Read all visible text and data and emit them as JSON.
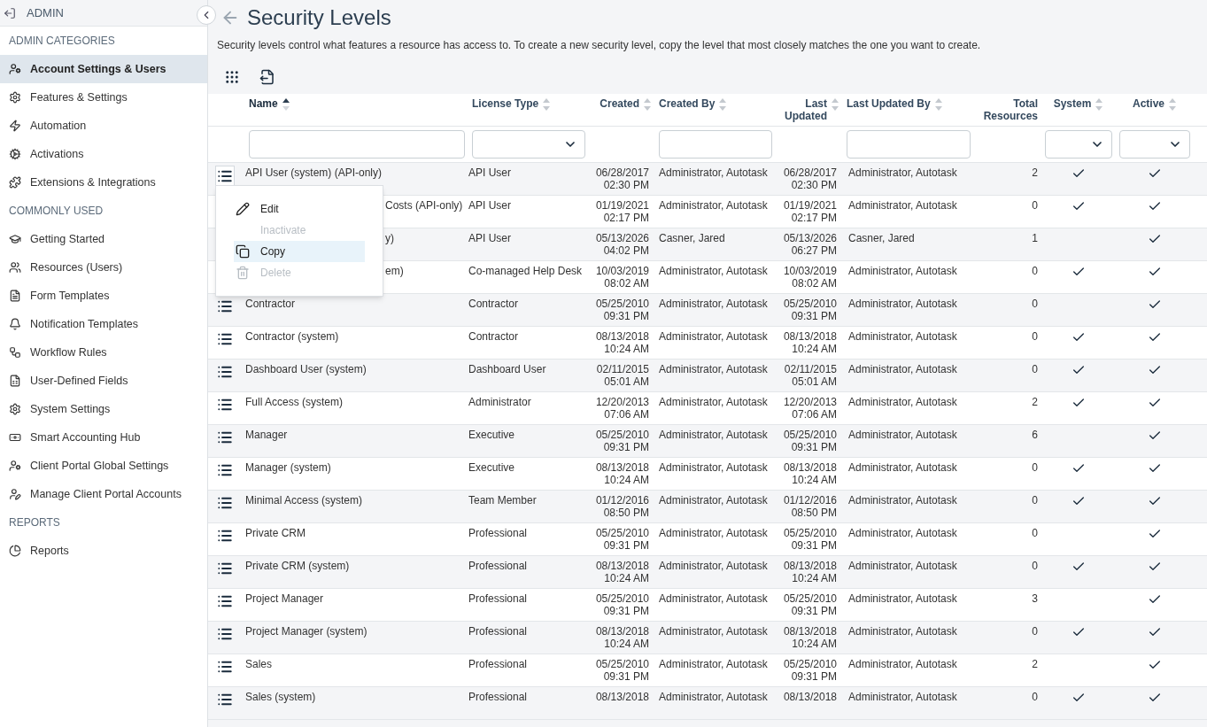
{
  "sidebar": {
    "header": "ADMIN",
    "sections": [
      {
        "title": "ADMIN CATEGORIES",
        "items": [
          {
            "label": "Account Settings & Users",
            "selected": true
          },
          {
            "label": "Features & Settings",
            "selected": false
          },
          {
            "label": "Automation",
            "selected": false
          },
          {
            "label": "Activations",
            "selected": false
          },
          {
            "label": "Extensions & Integrations",
            "selected": false
          }
        ]
      },
      {
        "title": "COMMONLY USED",
        "items": [
          {
            "label": "Getting Started",
            "selected": false
          },
          {
            "label": "Resources (Users)",
            "selected": false
          },
          {
            "label": "Form Templates",
            "selected": false
          },
          {
            "label": "Notification Templates",
            "selected": false
          },
          {
            "label": "Workflow Rules",
            "selected": false
          },
          {
            "label": "User-Defined Fields",
            "selected": false
          },
          {
            "label": "System Settings",
            "selected": false
          },
          {
            "label": "Smart Accounting Hub",
            "selected": false
          },
          {
            "label": "Client Portal Global Settings",
            "selected": false
          },
          {
            "label": "Manage Client Portal Accounts",
            "selected": false
          }
        ]
      },
      {
        "title": "REPORTS",
        "items": [
          {
            "label": "Reports",
            "selected": false
          }
        ]
      }
    ]
  },
  "page": {
    "title": "Security Levels",
    "description": "Security levels control what features a resource has access to. To create a new security level, copy the level that most closely matches the one you want to create."
  },
  "table": {
    "columns": [
      {
        "label": "Name",
        "sortable": true,
        "sorted": true,
        "filter": {
          "kind": "text"
        }
      },
      {
        "label": "License Type",
        "sortable": true,
        "sorted": false,
        "filter": {
          "kind": "select"
        }
      },
      {
        "label": "Created",
        "sortable": true,
        "sorted": false
      },
      {
        "label": "Created By",
        "sortable": true,
        "sorted": false,
        "filter": {
          "kind": "text"
        }
      },
      {
        "label": "Last Updated",
        "sortable": true,
        "sorted": false
      },
      {
        "label": "Last Updated By",
        "sortable": true,
        "sorted": false,
        "filter": {
          "kind": "text"
        }
      },
      {
        "label": "Total Resources",
        "sortable": false,
        "sorted": false
      },
      {
        "label": "System",
        "sortable": true,
        "sorted": false,
        "filter": {
          "kind": "select"
        }
      },
      {
        "label": "Active",
        "sortable": true,
        "sorted": false,
        "filter": {
          "kind": "select"
        }
      }
    ],
    "rows": [
      {
        "name": "API User (system) (API-only)",
        "license": "API User",
        "created_date": "06/28/2017",
        "created_time": "02:30 PM",
        "created_by": "Administrator, Autotask",
        "updated_date": "06/28/2017",
        "updated_time": "02:30 PM",
        "updated_by": "Administrator, Autotask",
        "total": "2",
        "system": true,
        "active": true,
        "menu_open": true
      },
      {
        "name": "Costs (API-only)",
        "license": "API User",
        "created_date": "01/19/2021",
        "created_time": "02:17 PM",
        "created_by": "Administrator, Autotask",
        "updated_date": "01/19/2021",
        "updated_time": "02:17 PM",
        "updated_by": "Administrator, Autotask",
        "total": "0",
        "system": true,
        "active": true,
        "covered": true
      },
      {
        "name": "y)",
        "license": "API User",
        "created_date": "05/13/2026",
        "created_time": "04:02 PM",
        "created_by": "Casner, Jared",
        "updated_date": "05/13/2026",
        "updated_time": "06:27 PM",
        "updated_by": "Casner, Jared",
        "total": "1",
        "system": false,
        "active": true,
        "covered": true
      },
      {
        "name": "em)",
        "license": "Co-managed Help Desk",
        "created_date": "10/03/2019",
        "created_time": "08:02 AM",
        "created_by": "Administrator, Autotask",
        "updated_date": "10/03/2019",
        "updated_time": "08:02 AM",
        "updated_by": "Administrator, Autotask",
        "total": "0",
        "system": true,
        "active": true,
        "covered": true
      },
      {
        "name": "Contractor",
        "license": "Contractor",
        "created_date": "05/25/2010",
        "created_time": "09:31 PM",
        "created_by": "Administrator, Autotask",
        "updated_date": "05/25/2010",
        "updated_time": "09:31 PM",
        "updated_by": "Administrator, Autotask",
        "total": "0",
        "system": false,
        "active": true
      },
      {
        "name": "Contractor (system)",
        "license": "Contractor",
        "created_date": "08/13/2018",
        "created_time": "10:24 AM",
        "created_by": "Administrator, Autotask",
        "updated_date": "08/13/2018",
        "updated_time": "10:24 AM",
        "updated_by": "Administrator, Autotask",
        "total": "0",
        "system": true,
        "active": true
      },
      {
        "name": "Dashboard User (system)",
        "license": "Dashboard User",
        "created_date": "02/11/2015",
        "created_time": "05:01 AM",
        "created_by": "Administrator, Autotask",
        "updated_date": "02/11/2015",
        "updated_time": "05:01 AM",
        "updated_by": "Administrator, Autotask",
        "total": "0",
        "system": true,
        "active": true
      },
      {
        "name": "Full Access (system)",
        "license": "Administrator",
        "created_date": "12/20/2013",
        "created_time": "07:06 AM",
        "created_by": "Administrator, Autotask",
        "updated_date": "12/20/2013",
        "updated_time": "07:06 AM",
        "updated_by": "Administrator, Autotask",
        "total": "2",
        "system": true,
        "active": true
      },
      {
        "name": "Manager",
        "license": "Executive",
        "created_date": "05/25/2010",
        "created_time": "09:31 PM",
        "created_by": "Administrator, Autotask",
        "updated_date": "05/25/2010",
        "updated_time": "09:31 PM",
        "updated_by": "Administrator, Autotask",
        "total": "6",
        "system": false,
        "active": true
      },
      {
        "name": "Manager (system)",
        "license": "Executive",
        "created_date": "08/13/2018",
        "created_time": "10:24 AM",
        "created_by": "Administrator, Autotask",
        "updated_date": "08/13/2018",
        "updated_time": "10:24 AM",
        "updated_by": "Administrator, Autotask",
        "total": "0",
        "system": true,
        "active": true
      },
      {
        "name": "Minimal Access (system)",
        "license": "Team Member",
        "created_date": "01/12/2016",
        "created_time": "08:50 PM",
        "created_by": "Administrator, Autotask",
        "updated_date": "01/12/2016",
        "updated_time": "08:50 PM",
        "updated_by": "Administrator, Autotask",
        "total": "0",
        "system": true,
        "active": true
      },
      {
        "name": "Private CRM",
        "license": "Professional",
        "created_date": "05/25/2010",
        "created_time": "09:31 PM",
        "created_by": "Administrator, Autotask",
        "updated_date": "05/25/2010",
        "updated_time": "09:31 PM",
        "updated_by": "Administrator, Autotask",
        "total": "0",
        "system": false,
        "active": true
      },
      {
        "name": "Private CRM (system)",
        "license": "Professional",
        "created_date": "08/13/2018",
        "created_time": "10:24 AM",
        "created_by": "Administrator, Autotask",
        "updated_date": "08/13/2018",
        "updated_time": "10:24 AM",
        "updated_by": "Administrator, Autotask",
        "total": "0",
        "system": true,
        "active": true
      },
      {
        "name": "Project Manager",
        "license": "Professional",
        "created_date": "05/25/2010",
        "created_time": "09:31 PM",
        "created_by": "Administrator, Autotask",
        "updated_date": "05/25/2010",
        "updated_time": "09:31 PM",
        "updated_by": "Administrator, Autotask",
        "total": "3",
        "system": false,
        "active": true
      },
      {
        "name": "Project Manager (system)",
        "license": "Professional",
        "created_date": "08/13/2018",
        "created_time": "10:24 AM",
        "created_by": "Administrator, Autotask",
        "updated_date": "08/13/2018",
        "updated_time": "10:24 AM",
        "updated_by": "Administrator, Autotask",
        "total": "0",
        "system": true,
        "active": true
      },
      {
        "name": "Sales",
        "license": "Professional",
        "created_date": "05/25/2010",
        "created_time": "09:31 PM",
        "created_by": "Administrator, Autotask",
        "updated_date": "05/25/2010",
        "updated_time": "09:31 PM",
        "updated_by": "Administrator, Autotask",
        "total": "2",
        "system": false,
        "active": true
      },
      {
        "name": "Sales (system)",
        "license": "Professional",
        "created_date": "08/13/2018",
        "created_by": "Administrator, Autotask",
        "updated_date": "08/13/2018",
        "updated_by": "Administrator, Autotask",
        "total": "0",
        "system": true,
        "active": true
      }
    ]
  },
  "context_menu": {
    "items": [
      {
        "label": "Edit",
        "disabled": false,
        "selected": false
      },
      {
        "label": "Inactivate",
        "disabled": true,
        "selected": false
      },
      {
        "label": "Copy",
        "disabled": false,
        "selected": true
      },
      {
        "label": "Delete",
        "disabled": true,
        "selected": false
      }
    ]
  }
}
